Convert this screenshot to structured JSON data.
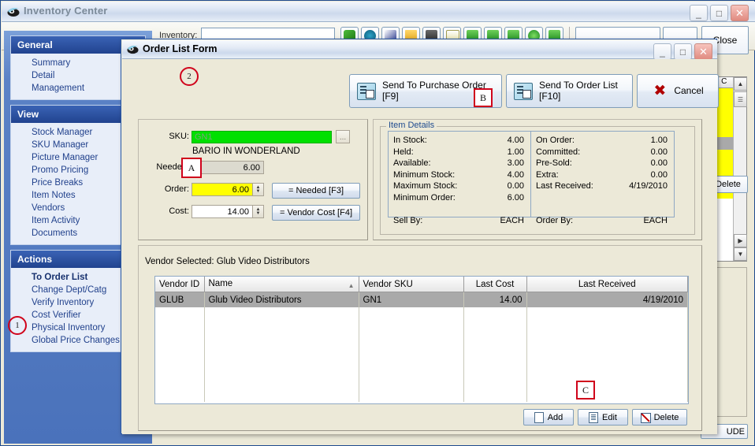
{
  "main_window": {
    "title": "Inventory Center",
    "icon": "app-icon",
    "window_buttons": {
      "minimize": "_",
      "maximize": "□",
      "close": "✕"
    },
    "toolbar": {
      "search_label": "Inventory:",
      "search_value": "",
      "close_button": "Close"
    },
    "right_grid": {
      "column_header": "On C"
    },
    "right_delete_button": "Delete",
    "bottom_button": "UDE"
  },
  "sidebar": {
    "groups": [
      {
        "header": "General",
        "items": [
          {
            "label": "Summary"
          },
          {
            "label": "Detail"
          },
          {
            "label": "Management"
          }
        ]
      },
      {
        "header": "View",
        "items": [
          {
            "label": "Stock Manager"
          },
          {
            "label": "SKU Manager"
          },
          {
            "label": "Picture Manager"
          },
          {
            "label": "Promo Pricing"
          },
          {
            "label": "Price Breaks"
          },
          {
            "label": "Item Notes"
          },
          {
            "label": "Vendors"
          },
          {
            "label": "Item Activity"
          },
          {
            "label": "Documents"
          }
        ]
      },
      {
        "header": "Actions",
        "items": [
          {
            "label": "To Order List",
            "bold": true
          },
          {
            "label": "Change Dept/Catg"
          },
          {
            "label": "Verify Inventory"
          },
          {
            "label": "Cost Verifier"
          },
          {
            "label": "Physical Inventory"
          },
          {
            "label": "Global Price Changes"
          }
        ]
      }
    ]
  },
  "dialog": {
    "title": "Order List Form",
    "icon": "app-icon",
    "window_buttons": {
      "minimize": "_",
      "maximize": "□",
      "close": "✕"
    },
    "toolbar": {
      "send_purchase_order": "Send To Purchase Order [F9]",
      "send_order_list": "Send To Order List\n[F10]",
      "cancel": "Cancel"
    },
    "order_form": {
      "sku_label": "SKU:",
      "sku_value": "GN1",
      "sku_browse": "...",
      "item_name": "BARIO IN WONDERLAND",
      "needed_label": "Needed:",
      "needed_value": "6.00",
      "order_label": "Order:",
      "order_value": "6.00",
      "cost_label": "Cost:",
      "cost_value": "14.00",
      "needed_button": "= Needed [F3]",
      "vendor_cost_button": "= Vendor Cost [F4]"
    },
    "item_details": {
      "legend": "Item Details",
      "left": [
        {
          "key": "In Stock:",
          "value": "4.00"
        },
        {
          "key": "Held:",
          "value": "1.00"
        },
        {
          "key": "Available:",
          "value": "3.00"
        },
        {
          "key": "Minimum Stock:",
          "value": "4.00"
        },
        {
          "key": "Maximum Stock:",
          "value": "0.00"
        },
        {
          "key": "Minimum Order:",
          "value": "6.00"
        }
      ],
      "left_footer": {
        "key": "Sell By:",
        "value": "EACH"
      },
      "right": [
        {
          "key": "On Order:",
          "value": "1.00"
        },
        {
          "key": "Committed:",
          "value": "0.00"
        },
        {
          "key": "Pre-Sold:",
          "value": "0.00"
        },
        {
          "key": "Extra:",
          "value": "0.00"
        },
        {
          "key": "Last Received:",
          "value": "4/19/2010"
        }
      ],
      "right_footer": {
        "key": "Order By:",
        "value": "EACH"
      }
    },
    "vendor_section": {
      "selected_label": "Vendor Selected:  Glub Video Distributors",
      "columns": [
        "Vendor ID",
        "Name",
        "Vendor SKU",
        "Last Cost",
        "Last Received"
      ],
      "rows": [
        {
          "vendor_id": "GLUB",
          "name": "Glub Video Distributors",
          "vendor_sku": "GN1",
          "last_cost": "14.00",
          "last_received": "4/19/2010"
        }
      ],
      "buttons": {
        "add": "Add",
        "edit": "Edit",
        "delete": "Delete"
      }
    }
  },
  "annotations": [
    {
      "id": "1",
      "shape": "circle"
    },
    {
      "id": "2",
      "shape": "circle"
    },
    {
      "id": "A",
      "shape": "square"
    },
    {
      "id": "B",
      "shape": "square"
    },
    {
      "id": "C",
      "shape": "square"
    }
  ],
  "colors": {
    "annotation": "#d0021b",
    "sku_highlight": "#00e000",
    "order_highlight": "#ffff00",
    "nav_header": "#21438f",
    "selected_row": "#a9a9a9"
  }
}
